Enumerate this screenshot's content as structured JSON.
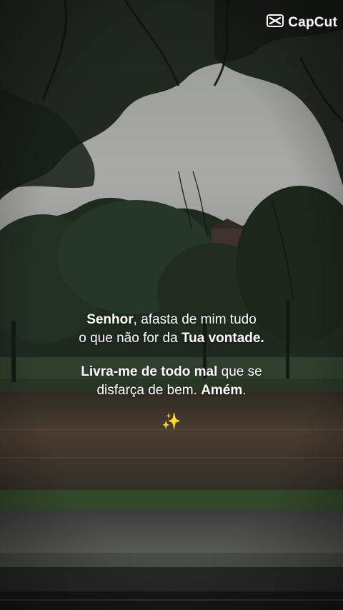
{
  "watermark": {
    "brand": "CapCut",
    "icon": "capcut-logo-icon"
  },
  "quote": {
    "paragraph1": {
      "line1": [
        {
          "text": "Senhor",
          "bold": true
        },
        {
          "text": ", afasta de mim tudo",
          "bold": false
        }
      ],
      "line2": [
        {
          "text": "o que não for da ",
          "bold": false
        },
        {
          "text": "Tua vontade.",
          "bold": true
        }
      ]
    },
    "paragraph2": {
      "line1": [
        {
          "text": "Livra-me de todo mal",
          "bold": true
        },
        {
          "text": " que se",
          "bold": false
        }
      ],
      "line2": [
        {
          "text": "disfarça de bem. ",
          "bold": false
        },
        {
          "text": "Amém",
          "bold": true
        },
        {
          "text": ".",
          "bold": false
        }
      ]
    },
    "emoji": "✨"
  },
  "colors": {
    "text": "#ffffff",
    "sky": "#c9cbc8",
    "foliage": "#1e2a1f",
    "water": "#4a4035"
  }
}
